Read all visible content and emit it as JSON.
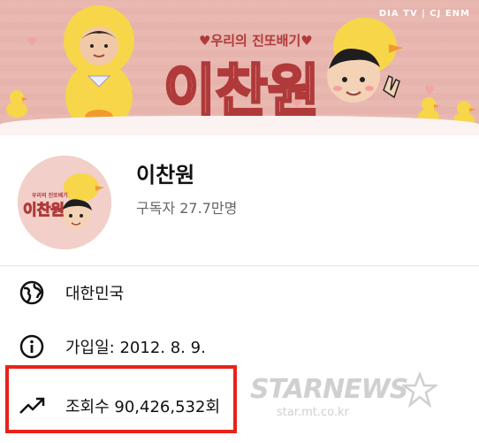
{
  "banner": {
    "brand": "DIA TV | CJ ENM",
    "subtitle": "♥우리의 진또배기♥",
    "title": "이찬원"
  },
  "channel": {
    "name": "이찬원",
    "subscribers": "구독자 27.7만명",
    "avatar_subtitle": "우리의 진또배기",
    "avatar_title": "이찬원"
  },
  "info": {
    "country": "대한민국",
    "joined": "가입일: 2012. 8. 9.",
    "views": "조회수 90,426,532회"
  },
  "icons": {
    "country": "globe-icon",
    "joined": "info-icon",
    "views": "trending-up-icon"
  },
  "colors": {
    "banner_bg": "#e8b8b0",
    "highlight": "#e8221a",
    "title_stroke": "#b03a3a"
  },
  "watermark": {
    "main": "STARNEWS",
    "sub": "star.mt.co.kr"
  }
}
